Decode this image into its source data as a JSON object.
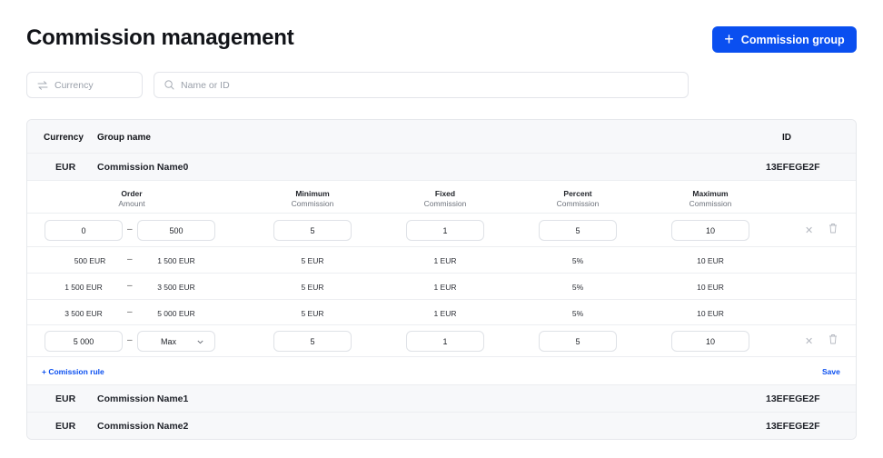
{
  "page": {
    "title": "Commission management"
  },
  "actions": {
    "add_group_label": "Commission group"
  },
  "filters": {
    "currency_placeholder": "Currency",
    "search_placeholder": "Name or ID"
  },
  "table": {
    "headers": {
      "currency": "Currency",
      "group_name": "Group name",
      "id": "ID"
    },
    "groups": [
      {
        "currency": "EUR",
        "name": "Commission Name0",
        "id": "13EFEGE2F"
      },
      {
        "currency": "EUR",
        "name": "Commission Name1",
        "id": "13EFEGE2F"
      },
      {
        "currency": "EUR",
        "name": "Commission Name2",
        "id": "13EFEGE2F"
      }
    ]
  },
  "rules": {
    "headers": [
      {
        "title": "Order",
        "sub": "Amount"
      },
      {
        "title": "Minimum",
        "sub": "Commission"
      },
      {
        "title": "Fixed",
        "sub": "Commission"
      },
      {
        "title": "Percent",
        "sub": "Commission"
      },
      {
        "title": "Maximum",
        "sub": "Commission"
      }
    ],
    "dash": "–",
    "edit_row_1": {
      "from": "0",
      "to": "500",
      "min": "5",
      "fixed": "1",
      "percent": "5",
      "max": "10"
    },
    "static_rows": [
      {
        "from": "500 EUR",
        "to": "1 500 EUR",
        "min": "5 EUR",
        "fixed": "1 EUR",
        "percent": "5%",
        "max": "10 EUR"
      },
      {
        "from": "1 500 EUR",
        "to": "3 500 EUR",
        "min": "5 EUR",
        "fixed": "1 EUR",
        "percent": "5%",
        "max": "10 EUR"
      },
      {
        "from": "3 500 EUR",
        "to": "5 000 EUR",
        "min": "5 EUR",
        "fixed": "1 EUR",
        "percent": "5%",
        "max": "10 EUR"
      }
    ],
    "edit_row_2": {
      "from": "5 000",
      "to": "Max",
      "min": "5",
      "fixed": "1",
      "percent": "5",
      "max": "10"
    },
    "add_rule_label": "+ Comission rule",
    "save_label": "Save"
  }
}
